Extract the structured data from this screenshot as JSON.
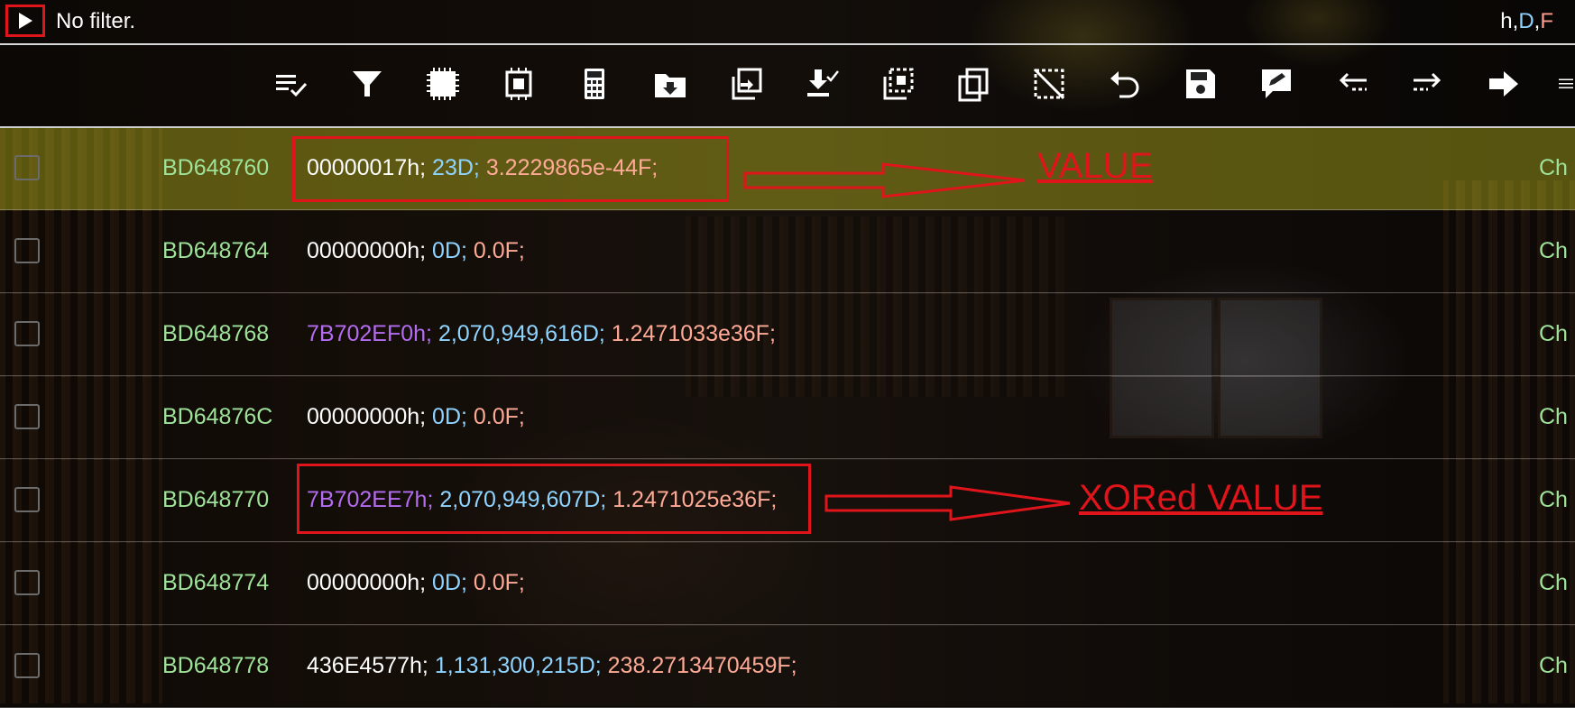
{
  "topbar": {
    "filter_text": "No filter.",
    "format_h": "h",
    "format_sep1": ",",
    "format_D": "D",
    "format_sep2": ",",
    "format_F": "F"
  },
  "toolbar": {
    "icons": [
      "select-all-icon",
      "filter-icon",
      "chip-icon",
      "chip-outline-icon",
      "calculator-icon",
      "folder-download-icon",
      "copy-paste-icon",
      "download-check-icon",
      "selection-copy-icon",
      "copy-icon",
      "selection-off-icon",
      "undo-icon",
      "save-icon",
      "edit-icon",
      "arrow-left-icon",
      "arrow-right-icon",
      "arrow-right-solid-icon",
      "menu-icon"
    ]
  },
  "rows": [
    {
      "address": "BD648760",
      "hex": "00000017h;",
      "dec": "23D;",
      "float": "3.2229865e-44F;",
      "hex_purple": false,
      "action": "Ch"
    },
    {
      "address": "BD648764",
      "hex": "00000000h;",
      "dec": "0D;",
      "float": "0.0F;",
      "hex_purple": false,
      "action": "Ch"
    },
    {
      "address": "BD648768",
      "hex": "7B702EF0h;",
      "dec": "2,070,949,616D;",
      "float": "1.2471033e36F;",
      "hex_purple": true,
      "action": "Ch"
    },
    {
      "address": "BD64876C",
      "hex": "00000000h;",
      "dec": "0D;",
      "float": "0.0F;",
      "hex_purple": false,
      "action": "Ch"
    },
    {
      "address": "BD648770",
      "hex": "7B702EE7h;",
      "dec": "2,070,949,607D;",
      "float": "1.2471025e36F;",
      "hex_purple": true,
      "action": "Ch"
    },
    {
      "address": "BD648774",
      "hex": "00000000h;",
      "dec": "0D;",
      "float": "0.0F;",
      "hex_purple": false,
      "action": "Ch"
    },
    {
      "address": "BD648778",
      "hex": "436E4577h;",
      "dec": "1,131,300,215D;",
      "float": "238.2713470459F;",
      "hex_purple": false,
      "action": "Ch"
    }
  ],
  "annotations": {
    "value_label": "VALUE",
    "xored_label": "XORed VALUE"
  },
  "colors": {
    "annotation_red": "#e0141b",
    "address_green": "#9fe39a",
    "decimal_blue": "#8fd4ff",
    "float_salmon": "#ffaa96",
    "hex_purple": "#b46cf0",
    "highlight_row": "#8c8c14"
  }
}
